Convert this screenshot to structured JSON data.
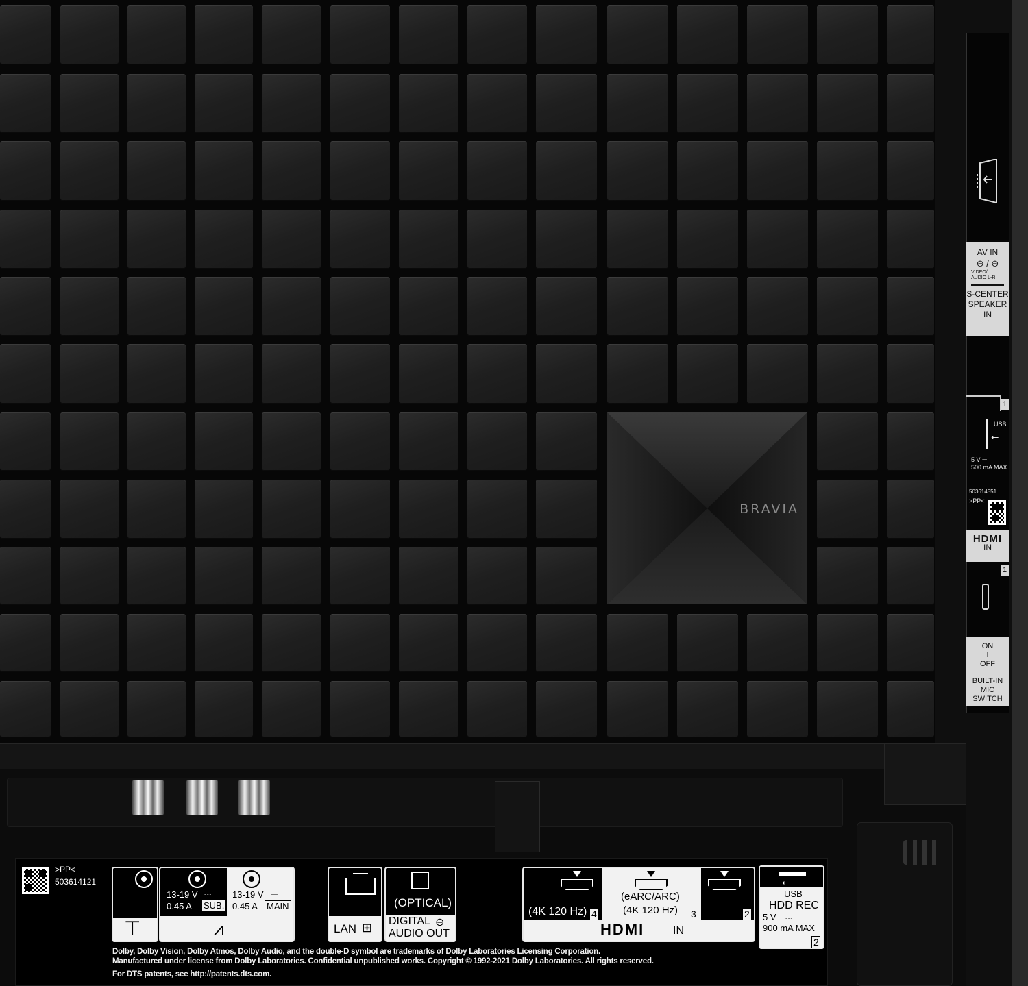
{
  "cover": {
    "brand": "BRAVIA"
  },
  "side": {
    "av_in": "AV IN",
    "av_sub": "VIDEO/\nAUDIO L-R",
    "scenter": "S-CENTER\nSPEAKER IN",
    "usb_num": "1",
    "usb_label": "USB",
    "usb_power": "5 V ⎓\n500 mA MAX",
    "serial_small": "503614551",
    "pp_small": ">PP<",
    "hdmi_logo": "HDMI",
    "hdmi_in": "IN",
    "hdmi_num": "1",
    "mic_on": "ON",
    "mic_sep": "I",
    "mic_off": "OFF",
    "mic_label": "BUILT-IN\nMIC SWITCH"
  },
  "bottom": {
    "pp": ">PP<",
    "serial": "503614121",
    "sub_voltage": "13-19  V",
    "sub_current": "0.45  A",
    "sub_label": "SUB.",
    "main_voltage": "13-19  V",
    "main_current": "0.45  A",
    "main_label": "MAIN",
    "lan": "LAN",
    "optical": "(OPTICAL)",
    "digital_audio_out": "DIGITAL\nAUDIO OUT",
    "hdmi4_rate": "(4K 120 Hz)",
    "hdmi4_num": "4",
    "hdmi3_arc": "(eARC/ARC)",
    "hdmi3_rate": "(4K 120 Hz)",
    "hdmi3_num": "3",
    "hdmi2_num": "2",
    "hdmi_logo": "HDMI",
    "hdmi_in": "IN",
    "usb_label": "USB",
    "hdd_rec": "HDD REC",
    "usb_voltage": "5 V",
    "usb_current": "900 mA MAX",
    "usb_num": "2"
  },
  "legal": {
    "line1": "Dolby, Dolby Vision, Dolby Atmos, Dolby Audio, and the double-D symbol are trademarks of Dolby Laboratories Licensing Corporation.",
    "line2": "Manufactured under license from Dolby Laboratories. Confidential unpublished works. Copyright © 1992-2021 Dolby Laboratories. All rights reserved.",
    "line3": "For DTS patents, see http://patents.dts.com."
  },
  "colors": {
    "tile": "#242424",
    "label_bg": "#f2f2f2",
    "panel_bg": "#000000"
  }
}
